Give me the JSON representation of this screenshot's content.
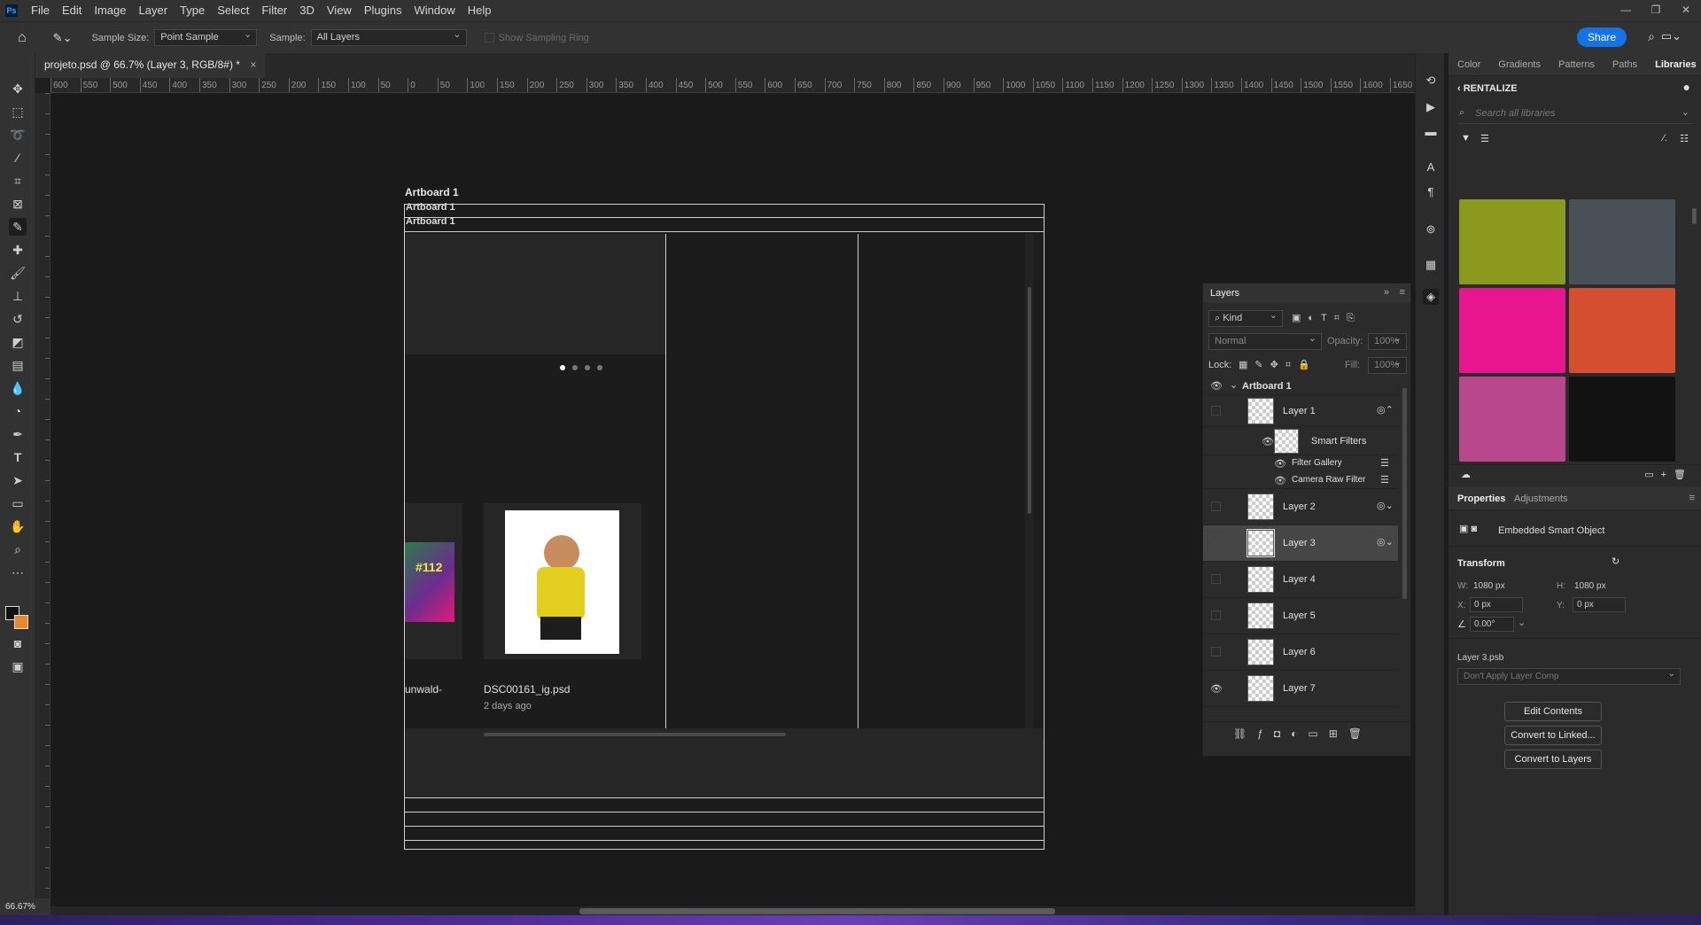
{
  "menubar": {
    "app_logo": "Ps",
    "items": [
      "File",
      "Edit",
      "Image",
      "Layer",
      "Type",
      "Select",
      "Filter",
      "3D",
      "View",
      "Plugins",
      "Window",
      "Help"
    ]
  },
  "options": {
    "sample_size_label": "Sample Size:",
    "sample_size_value": "Point Sample",
    "sample_label": "Sample:",
    "sample_value": "All Layers",
    "show_sampling_ring": "Show Sampling Ring",
    "share_label": "Share"
  },
  "document": {
    "tab_title": "projeto.psd @ 66.7% (Layer 3, RGB/8#) *",
    "zoom": "66.67%"
  },
  "ruler": {
    "h_labels": [
      "600",
      "550",
      "500",
      "450",
      "400",
      "350",
      "300",
      "250",
      "200",
      "150",
      "100",
      "50",
      "0",
      "50",
      "100",
      "150",
      "200",
      "250",
      "300",
      "350",
      "400",
      "450",
      "500",
      "550",
      "600",
      "650",
      "700",
      "750",
      "800",
      "850",
      "900",
      "950",
      "1000",
      "1050",
      "1100",
      "1150",
      "1200",
      "1250",
      "1300",
      "1350",
      "1400",
      "1450",
      "1500",
      "1550",
      "1600",
      "1650"
    ]
  },
  "canvas": {
    "artboard_label": "Artboard 1",
    "artboard_header_1": "Artboard 1",
    "artboard_header_2": "Artboard 1",
    "card1_caption": "unwald-",
    "card1_badge": "#112",
    "card2_filename": "DSC00161_ig.psd",
    "card2_meta": "2 days ago"
  },
  "libraries": {
    "tabs": [
      "Color",
      "Gradients",
      "Patterns",
      "Paths",
      "Libraries"
    ],
    "active_tab": "Libraries",
    "library_name": "RENTALIZE",
    "search_placeholder": "Search all libraries",
    "swatches": [
      "#8b9a1c",
      "#4a5058",
      "#e8158f",
      "#d64e30",
      "#b8478c",
      "#121212"
    ]
  },
  "layers": {
    "title": "Layers",
    "filter_kind": "Kind",
    "blend_mode": "Normal",
    "opacity_label": "Opacity:",
    "opacity_value": "100%",
    "lock_label": "Lock:",
    "fill_label": "Fill:",
    "fill_value": "100%",
    "artboard": "Artboard 1",
    "items": [
      {
        "name": "Layer 1",
        "visible": false
      },
      {
        "name": "Smart Filters",
        "visible": true
      },
      {
        "name": "Filter Gallery",
        "visible": true
      },
      {
        "name": "Camera Raw Filter",
        "visible": true
      },
      {
        "name": "Layer 2",
        "visible": false
      },
      {
        "name": "Layer 3",
        "visible": false
      },
      {
        "name": "Layer 4",
        "visible": false
      },
      {
        "name": "Layer 5",
        "visible": false
      },
      {
        "name": "Layer 6",
        "visible": false
      },
      {
        "name": "Layer 7",
        "visible": true
      }
    ]
  },
  "properties": {
    "tabs": [
      "Properties",
      "Adjustments"
    ],
    "active_tab": "Properties",
    "object_type": "Embedded Smart Object",
    "transform_title": "Transform",
    "w_label": "W:",
    "w_value": "1080 px",
    "h_label": "H:",
    "h_value": "1080 px",
    "x_label": "X:",
    "x_value": "0 px",
    "y_label": "Y:",
    "y_value": "0 px",
    "angle_value": "0.00°",
    "file_name": "Layer 3.psb",
    "layer_comp": "Don't Apply Layer Comp",
    "edit_contents": "Edit Contents",
    "convert_linked": "Convert to Linked...",
    "convert_layers": "Convert to Layers"
  }
}
